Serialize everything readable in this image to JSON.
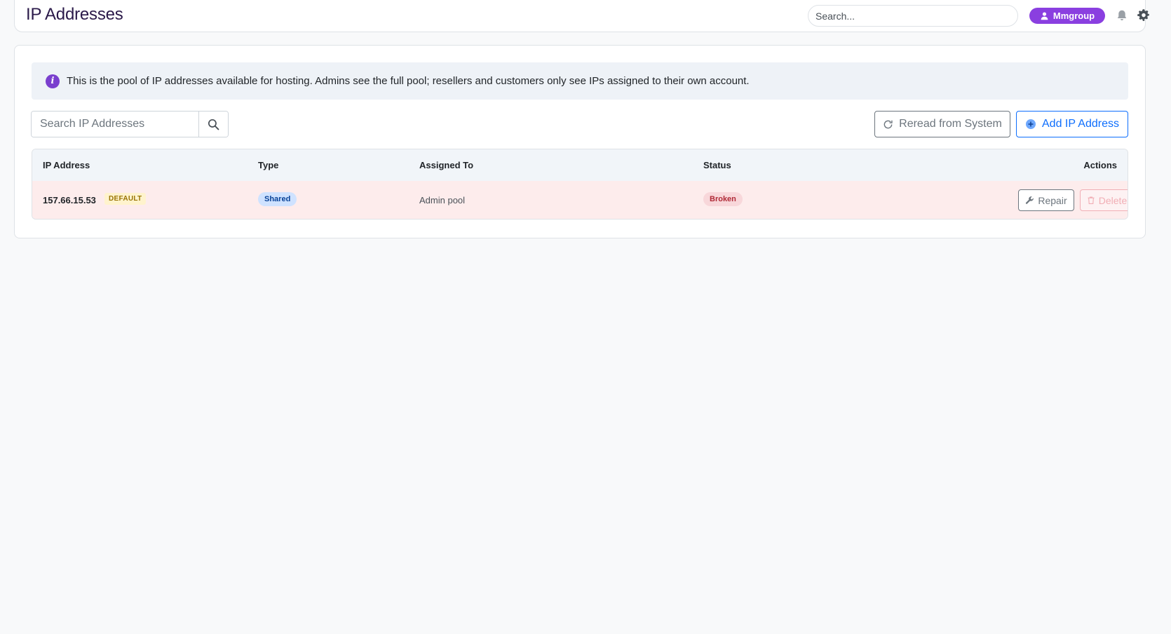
{
  "header": {
    "title": "IP Addresses",
    "search_placeholder": "Search...",
    "user_name": "Mmgroup"
  },
  "info": {
    "text": "This is the pool of IP addresses available for hosting. Admins see the full pool; resellers and customers only see IPs assigned to their own account."
  },
  "toolbar": {
    "search_placeholder": "Search IP Addresses",
    "reread_label": "Reread from System",
    "add_label": "Add IP Address"
  },
  "table": {
    "columns": [
      "IP Address",
      "Type",
      "Assigned To",
      "Status",
      "Actions"
    ],
    "rows": [
      {
        "ip": "157.66.15.53",
        "default_badge": "DEFAULT",
        "type": "Shared",
        "assigned_to": "Admin pool",
        "status": "Broken",
        "repair_label": "Repair",
        "delete_label": "Delete"
      }
    ]
  },
  "colors": {
    "accent_purple": "#8a3fe0",
    "primary_blue": "#0d6efd",
    "broken_row_bg": "#fdecec"
  },
  "icons": [
    "info-icon",
    "user-icon",
    "bell-icon",
    "gear-icon",
    "search-icon",
    "refresh-icon",
    "plus-circle-icon",
    "wrench-icon",
    "trash-icon"
  ]
}
